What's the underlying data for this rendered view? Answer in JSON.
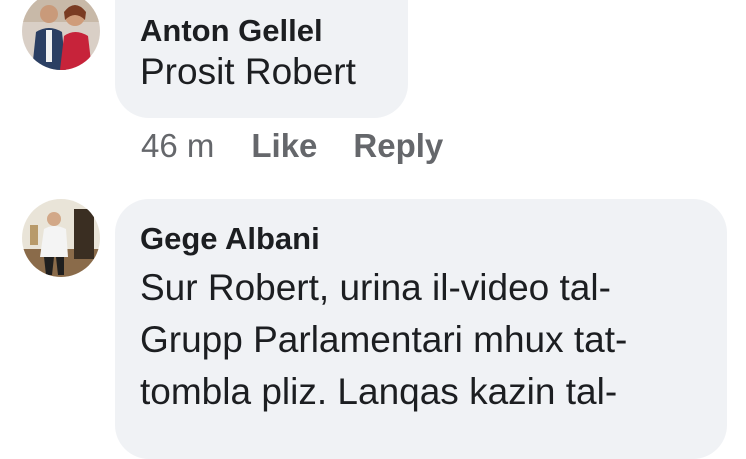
{
  "comments": [
    {
      "author": "Anton Gellel",
      "text": "Prosit Robert",
      "time": "46 m",
      "like_label": "Like",
      "reply_label": "Reply",
      "avatar_icon": "profile-photo-couple"
    },
    {
      "author": "Gege Albani",
      "lines": [
        "Sur Robert, urina il-video tal-",
        "Grupp Parlamentari mhux tat-",
        "tombla pliz. Lanqas kazin tal-"
      ],
      "avatar_icon": "profile-photo-figure"
    }
  ]
}
